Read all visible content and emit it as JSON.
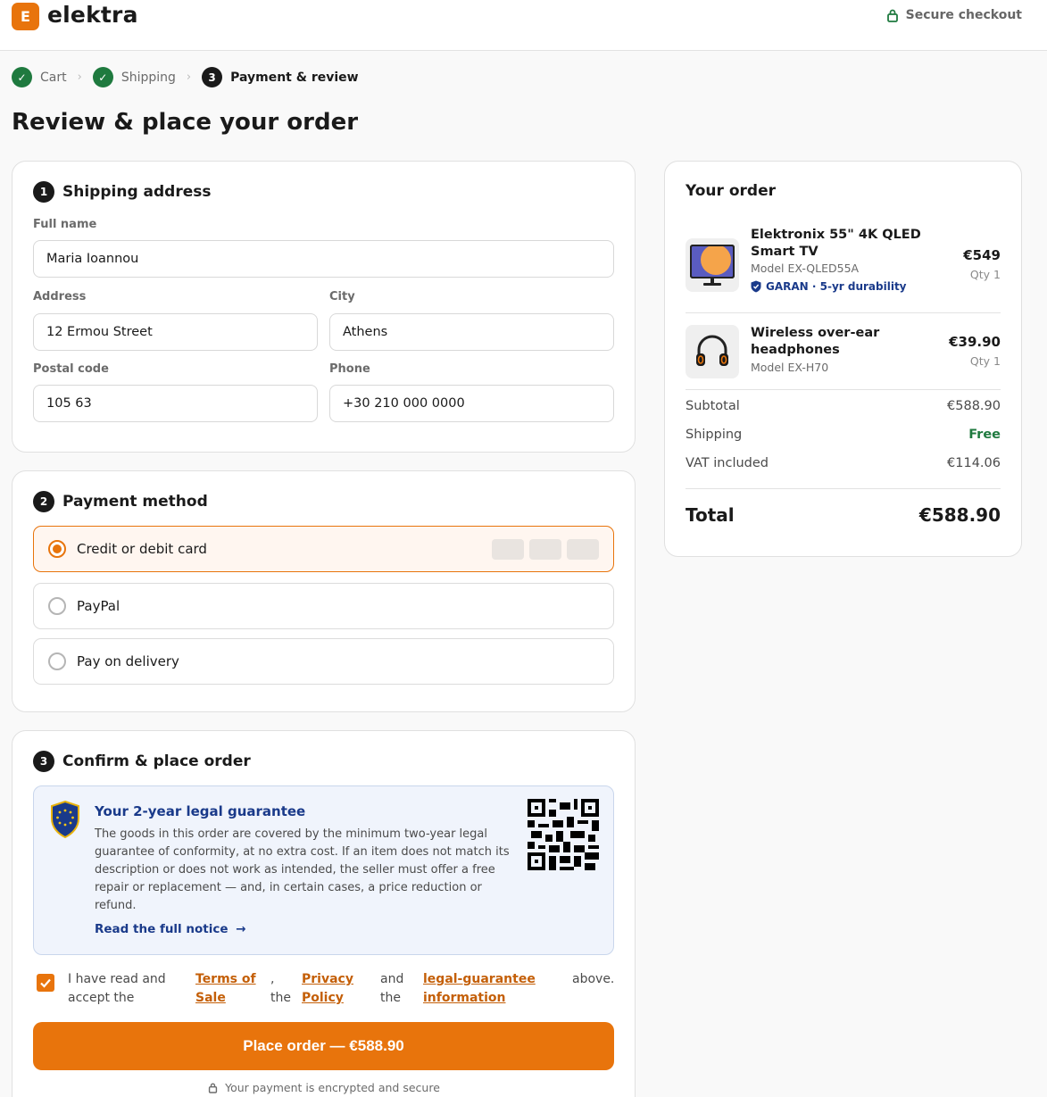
{
  "header": {
    "logo_letter": "E",
    "brand": "elektra",
    "secure_label": "Secure checkout"
  },
  "steps": [
    {
      "label": "Cart",
      "state": "done"
    },
    {
      "label": "Shipping",
      "state": "done"
    },
    {
      "label": "Payment & review",
      "state": "active",
      "number": "3"
    }
  ],
  "page_title": "Review & place your order",
  "shipping": {
    "number": "1",
    "title": "Shipping address",
    "fields": {
      "full_name": {
        "label": "Full name",
        "value": "Maria Ioannou"
      },
      "address": {
        "label": "Address",
        "value": "12 Ermou Street"
      },
      "city": {
        "label": "City",
        "value": "Athens"
      },
      "postal_code": {
        "label": "Postal code",
        "value": "105 63"
      },
      "phone": {
        "label": "Phone",
        "value": "+30 210 000 0000"
      }
    }
  },
  "payment": {
    "number": "2",
    "title": "Payment method",
    "options": [
      {
        "label": "Credit or debit card",
        "selected": true
      },
      {
        "label": "PayPal",
        "selected": false
      },
      {
        "label": "Pay on delivery",
        "selected": false
      }
    ]
  },
  "confirm": {
    "number": "3",
    "title": "Confirm & place order",
    "guarantee": {
      "title": "Your 2-year legal guarantee",
      "body": "The goods in this order are covered by the minimum two-year legal guarantee of conformity, at no extra cost. If an item does not match its description or does not work as intended, the seller must offer a free repair or replacement — and, in certain cases, a price reduction or refund.",
      "link": "Read the full notice"
    },
    "accept": {
      "text_1": "I have read and accept the",
      "link_terms": "Terms of Sale",
      "sep_1": ", the",
      "link_privacy": "Privacy Policy",
      "sep_2": "and the",
      "link_guarantee": "legal-guarantee information",
      "text_end": "above.",
      "checked": true
    },
    "place_order_label": "Place order — €588.90",
    "encrypted_note": "Your payment is encrypted and secure"
  },
  "order": {
    "title": "Your order",
    "items": [
      {
        "name": "Elektronix 55\" 4K QLED Smart TV",
        "model": "Model EX-QLED55A",
        "badge": "GARAN · 5-yr durability",
        "price": "€549",
        "qty": "Qty 1"
      },
      {
        "name": "Wireless over-ear headphones",
        "model": "Model EX-H70",
        "price": "€39.90",
        "qty": "Qty 1"
      }
    ],
    "subtotal_label": "Subtotal",
    "subtotal": "€588.90",
    "shipping_label": "Shipping",
    "shipping": "Free",
    "vat_label": "VAT included",
    "vat": "€114.06",
    "total_label": "Total",
    "total": "€588.90"
  },
  "colors": {
    "accent": "#e8740c",
    "success": "#1f7a3f",
    "guarantee_blue": "#1a3a8a"
  }
}
